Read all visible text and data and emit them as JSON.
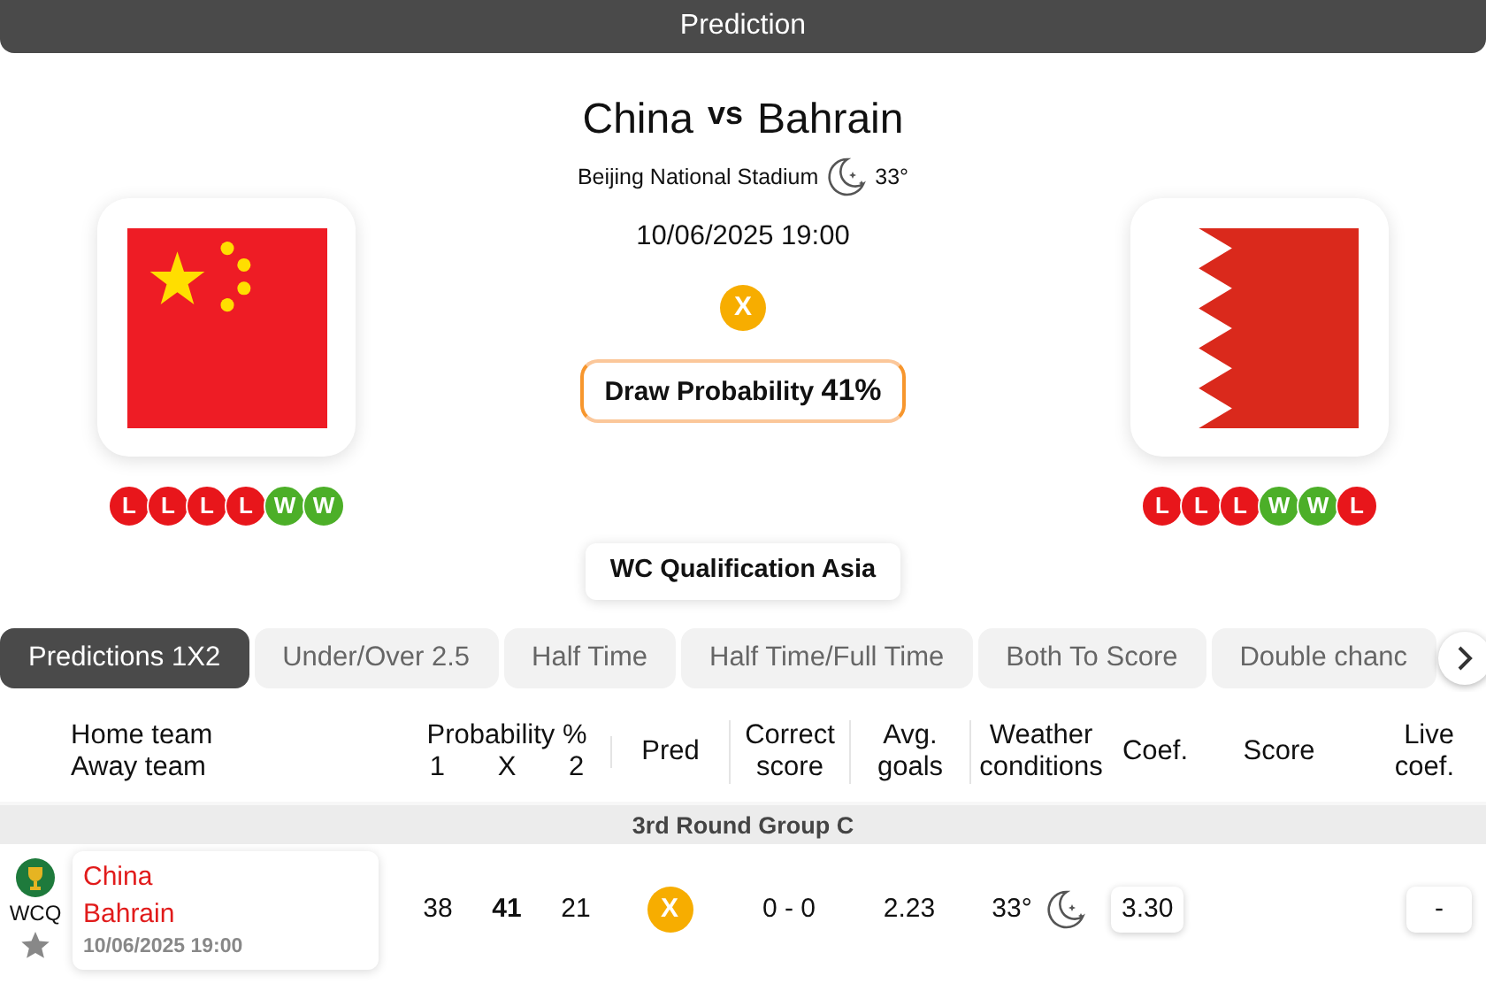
{
  "header": {
    "title": "Prediction"
  },
  "match": {
    "home": "China",
    "vs": "vs",
    "away": "Bahrain",
    "venue": "Beijing National Stadium",
    "temperature": "33°",
    "datetime": "10/06/2025 19:00",
    "pick": "X",
    "draw_label": "Draw Probability",
    "draw_value": "41%",
    "competition": "WC Qualification Asia",
    "home_form": [
      {
        "label": "L",
        "color": "#e8161b"
      },
      {
        "label": "L",
        "color": "#e8161b"
      },
      {
        "label": "L",
        "color": "#e8161b"
      },
      {
        "label": "L",
        "color": "#e8161b"
      },
      {
        "label": "W",
        "color": "#4caf28"
      },
      {
        "label": "W",
        "color": "#4caf28"
      }
    ],
    "away_form": [
      {
        "label": "L",
        "color": "#e8161b"
      },
      {
        "label": "L",
        "color": "#e8161b"
      },
      {
        "label": "L",
        "color": "#e8161b"
      },
      {
        "label": "W",
        "color": "#4caf28"
      },
      {
        "label": "W",
        "color": "#4caf28"
      },
      {
        "label": "L",
        "color": "#e8161b"
      }
    ]
  },
  "tabs": [
    {
      "label": "Predictions 1X2",
      "selected": true
    },
    {
      "label": "Under/Over 2.5",
      "selected": false
    },
    {
      "label": "Half Time",
      "selected": false
    },
    {
      "label": "Half Time/Full Time",
      "selected": false
    },
    {
      "label": "Both To Score",
      "selected": false
    },
    {
      "label": "Double chanc",
      "selected": false
    }
  ],
  "table": {
    "columns": [
      {
        "lines": [
          "Home team",
          "Away team"
        ]
      },
      {
        "lines": [
          "Probability %"
        ],
        "sub": [
          "1",
          "X",
          "2"
        ]
      },
      {
        "lines": [
          "Pred"
        ]
      },
      {
        "lines": [
          "Correct",
          "score"
        ]
      },
      {
        "lines": [
          "Avg.",
          "goals"
        ]
      },
      {
        "lines": [
          "Weather",
          "conditions"
        ]
      },
      {
        "lines": [
          "Coef."
        ]
      },
      {
        "lines": [
          "Score"
        ]
      },
      {
        "lines": [
          "Live",
          "coef."
        ]
      }
    ],
    "group": "3rd Round Group C",
    "rows": [
      {
        "league": "WCQ",
        "home": "China",
        "away": "Bahrain",
        "datetime": "10/06/2025 19:00",
        "probabilities": [
          {
            "value": "38",
            "emphasized": false
          },
          {
            "value": "41",
            "emphasized": true
          },
          {
            "value": "21",
            "emphasized": false
          }
        ],
        "pick": "X",
        "correct_score": "0 - 0",
        "avg_goals": "2.23",
        "temperature": "33°",
        "coef": "3.30",
        "live_coef": "-"
      }
    ]
  }
}
